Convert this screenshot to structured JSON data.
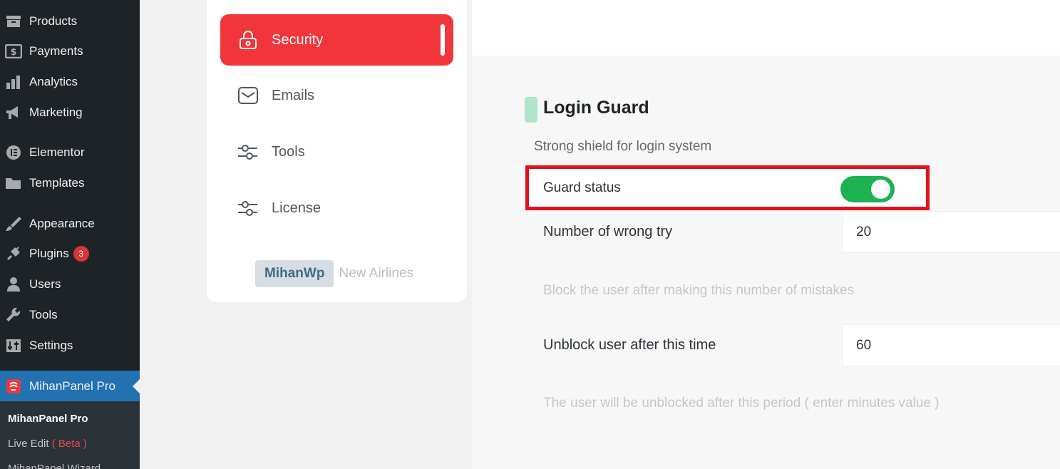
{
  "wp_menu": {
    "items": [
      {
        "label": "Products",
        "icon": "archive-icon"
      },
      {
        "label": "Payments",
        "icon": "dollar-icon"
      },
      {
        "label": "Analytics",
        "icon": "bar-chart-icon"
      },
      {
        "label": "Marketing",
        "icon": "megaphone-icon"
      },
      {
        "label": "Elementor",
        "icon": "elementor-icon"
      },
      {
        "label": "Templates",
        "icon": "folder-icon"
      },
      {
        "label": "Appearance",
        "icon": "brush-icon"
      },
      {
        "label": "Plugins",
        "icon": "plug-icon",
        "badge": "3"
      },
      {
        "label": "Users",
        "icon": "user-icon"
      },
      {
        "label": "Tools",
        "icon": "wrench-icon"
      },
      {
        "label": "Settings",
        "icon": "sliders-icon"
      },
      {
        "label": "MihanPanel Pro",
        "icon": "mihanpanel-icon"
      }
    ],
    "submenu": {
      "item1": "MihanPanel Pro",
      "item2_text": "Live Edit",
      "item2_beta": "( Beta )",
      "item3": "MihanPanel Wizard"
    }
  },
  "settings_menu": {
    "items": [
      {
        "label": "Security",
        "icon": "lock-icon"
      },
      {
        "label": "Emails",
        "icon": "envelope-icon"
      },
      {
        "label": "Tools",
        "icon": "sliders-icon"
      },
      {
        "label": "License",
        "icon": "sliders-icon"
      }
    ],
    "brand_tag": "MihanWp",
    "brand_text": "New Airlines"
  },
  "login_guard": {
    "title": "Login Guard",
    "subtitle": "Strong shield for login system",
    "guard_status_label": "Guard status",
    "guard_status_on": true,
    "wrong_try_label": "Number of wrong try",
    "wrong_try_value": "20",
    "wrong_try_help": "Block the user after making this number of mistakes",
    "unblock_label": "Unblock user after this time",
    "unblock_value": "60",
    "unblock_help": "The user will be unblocked after this period ( enter minutes value )"
  },
  "colors": {
    "wp_sidebar": "#1d2327",
    "wp_current": "#2271b1",
    "accent_red": "#f0363b",
    "toggle_green": "#1cb252",
    "highlight_box": "#e1121c",
    "section_mark": "#b1e5cb"
  }
}
